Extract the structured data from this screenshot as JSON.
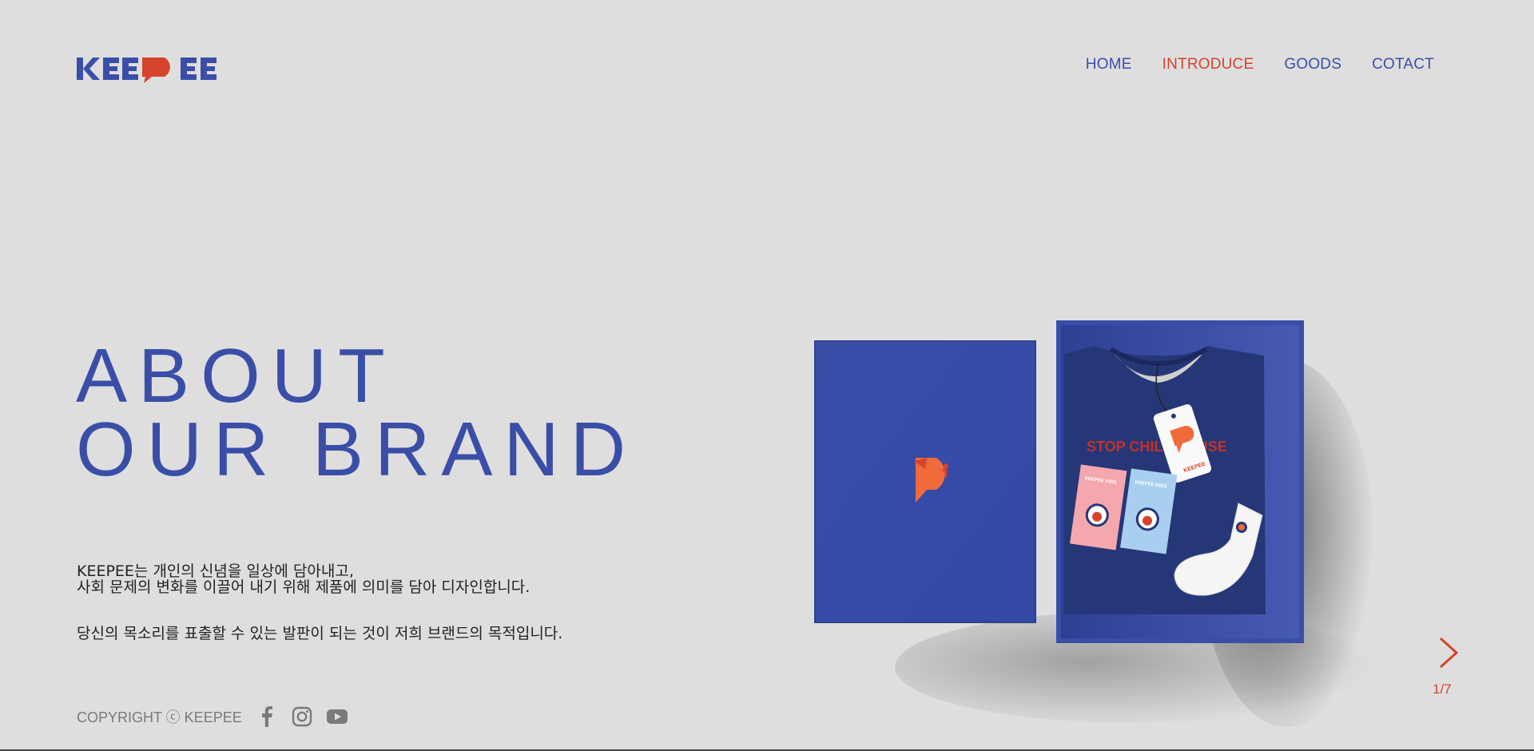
{
  "brand": {
    "logo_text": "KEEPEE",
    "primary_color": "#3a4ea8",
    "accent_color": "#d5432c"
  },
  "nav": [
    {
      "label": "HOME",
      "active": false
    },
    {
      "label": "INTRODUCE",
      "active": true
    },
    {
      "label": "GOODS",
      "active": false
    },
    {
      "label": "COTACT",
      "active": false
    }
  ],
  "hero": {
    "title_line1": "ABOUT",
    "title_line2": "OUR BRAND"
  },
  "description": {
    "line1": "KEEPEE는 개인의 신념을 일상에 담아내고,",
    "line2": "사회 문제의 변화를 이끌어 내기 위해 제품에 의미를 담아 디자인합니다.",
    "line3": "당신의 목소리를 표출할 수 있는 발판이 되는 것이 저희 브랜드의 목적입니다."
  },
  "footer": {
    "copyright": "COPYRIGHT ⓒ KEEPEE",
    "social_icons": [
      "facebook-icon",
      "instagram-icon",
      "youtube-icon"
    ]
  },
  "product_image": {
    "shirt_print": "STOP CHILD ABUSE",
    "card_label": "KEEPEE KIDS",
    "tag_label": "KEEPEE"
  },
  "slider": {
    "current": 1,
    "total": 7,
    "counter_text": "1/7"
  }
}
